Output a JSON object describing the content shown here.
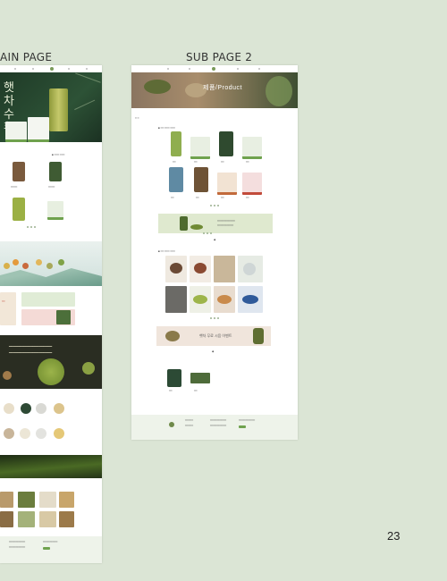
{
  "labels": {
    "main_page": "AIN PAGE",
    "sub_page_2": "SUB PAGE 2"
  },
  "page_number": "23",
  "main": {
    "hero_title": "햇차 수확",
    "banner_title": "바로구매",
    "colors": {
      "dark_green": "#23402c",
      "tea_green": "#8fae4f",
      "accent_red": "#c24b3b"
    }
  },
  "sub": {
    "hero_title": "제품/Product",
    "promo_text": "햇차 무료 시음 이벤트",
    "colors": {
      "hero_brown": "#8a7560",
      "promo_green": "#dfe9cf"
    }
  }
}
